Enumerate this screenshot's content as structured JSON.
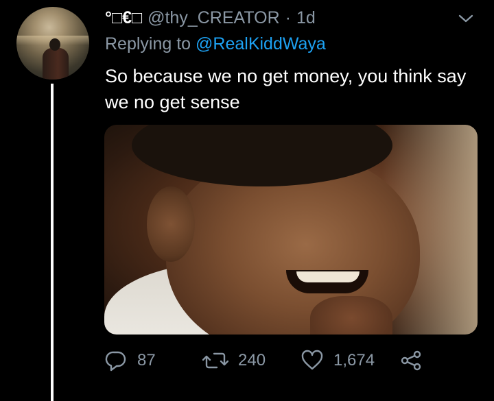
{
  "tweet": {
    "display_name": "°□€□",
    "handle": "@thy_CREATOR",
    "separator": "·",
    "time": "1d",
    "reply_prefix": "Replying to",
    "reply_to": "@RealKiddWaya",
    "text": "So because we no get money, you think say we no get sense"
  },
  "actions": {
    "reply_count": "87",
    "retweet_count": "240",
    "like_count": "1,674"
  },
  "icons": {
    "more": "chevron-down-icon",
    "reply": "reply-icon",
    "retweet": "retweet-icon",
    "like": "heart-icon",
    "share": "share-icon"
  },
  "colors": {
    "background": "#000000",
    "text": "#ffffff",
    "secondary": "#8b98a5",
    "link": "#1da1f2"
  }
}
